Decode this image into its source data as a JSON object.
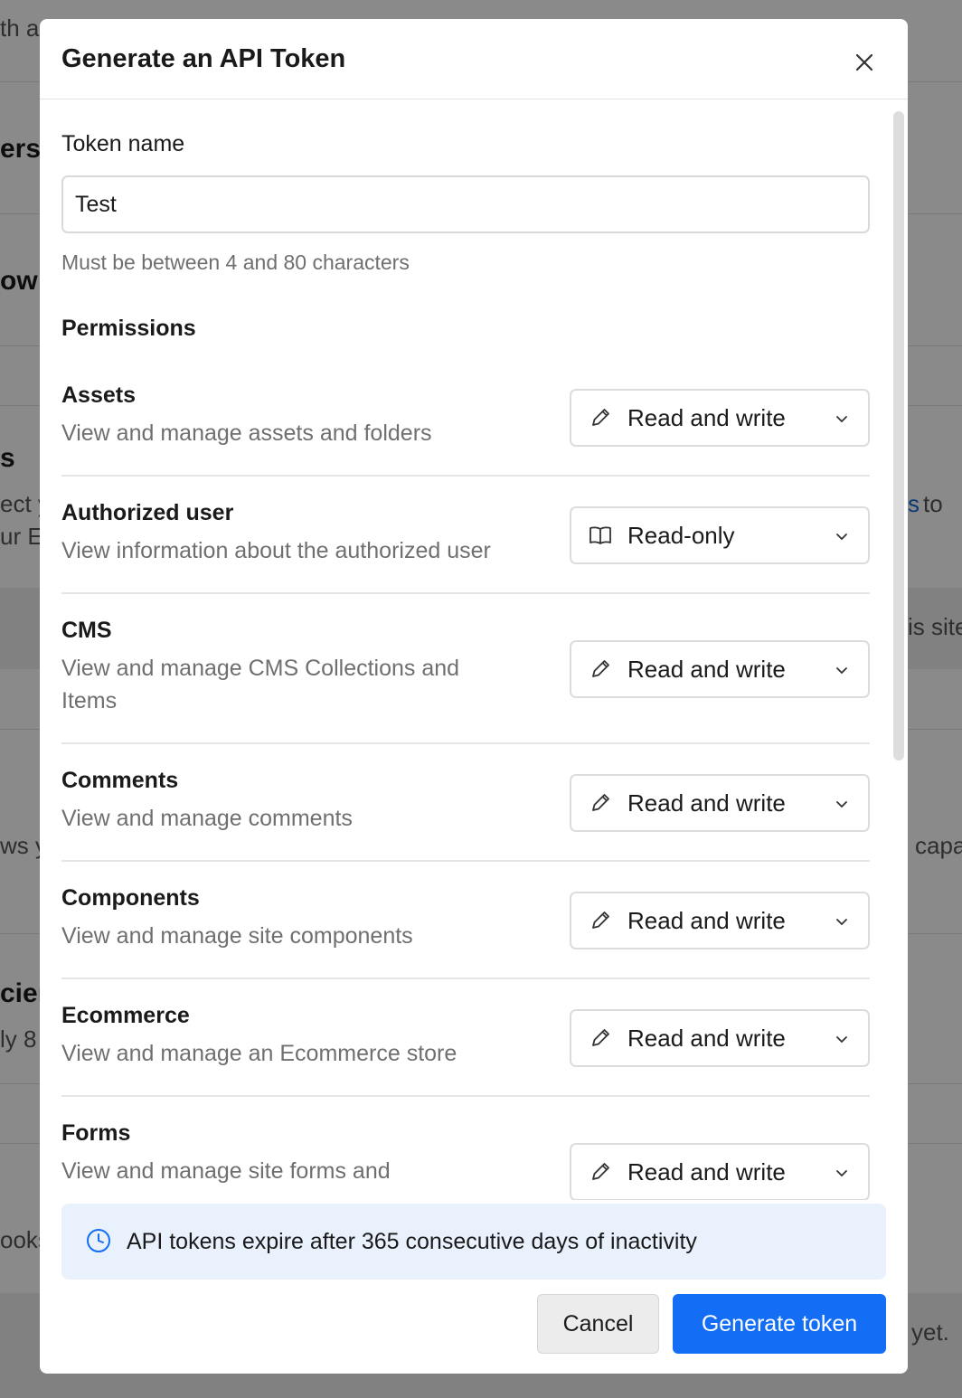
{
  "background": {
    "fragments": [
      "th a",
      "ers",
      "ow l",
      "s",
      "ect y",
      "ur En",
      "s",
      "to",
      "is site",
      "ws y",
      "capa",
      "cien",
      "ly 8",
      "ooks",
      "yet."
    ]
  },
  "modal": {
    "title": "Generate an API Token",
    "close_icon": "close-icon",
    "token_name": {
      "label": "Token name",
      "value": "Test",
      "hint": "Must be between 4 and 80 characters"
    },
    "permissions_title": "Permissions",
    "permissions": [
      {
        "name": "Assets",
        "description": "View and manage assets and folders",
        "access": "Read and write",
        "icon": "pencil-icon"
      },
      {
        "name": "Authorized user",
        "description": "View information about the authorized user",
        "access": "Read-only",
        "icon": "book-icon"
      },
      {
        "name": "CMS",
        "description": "View and manage CMS Collections and Items",
        "access": "Read and write",
        "icon": "pencil-icon"
      },
      {
        "name": "Comments",
        "description": "View and manage comments",
        "access": "Read and write",
        "icon": "pencil-icon"
      },
      {
        "name": "Components",
        "description": "View and manage site components",
        "access": "Read and write",
        "icon": "pencil-icon"
      },
      {
        "name": "Ecommerce",
        "description": "View and manage an Ecommerce store",
        "access": "Read and write",
        "icon": "pencil-icon"
      },
      {
        "name": "Forms",
        "description": "View and manage site forms and",
        "access": "Read and write",
        "icon": "pencil-icon"
      }
    ],
    "info": {
      "icon": "clock-icon",
      "text": "API tokens expire after 365 consecutive days of inactivity"
    },
    "buttons": {
      "cancel": "Cancel",
      "generate": "Generate token"
    },
    "colors": {
      "primary": "#146ef5",
      "info_bg": "#e9f1fd"
    }
  }
}
